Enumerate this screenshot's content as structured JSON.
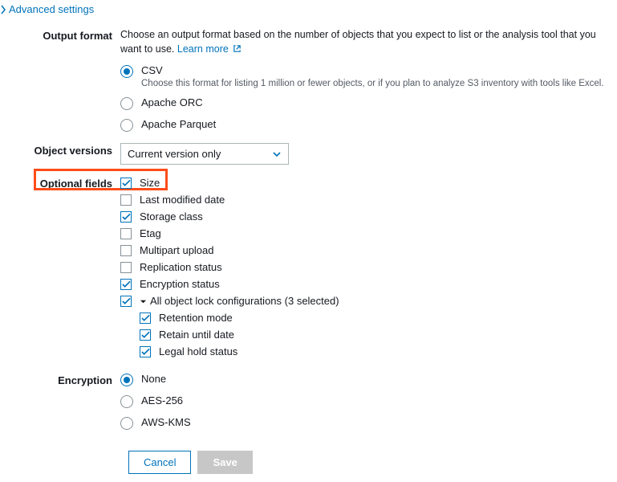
{
  "advanced_link": "Advanced settings",
  "output_format": {
    "label": "Output format",
    "description": "Choose an output format based on the number of objects that you expect to list or the analysis tool that you want to use.",
    "learn_more": "Learn more",
    "options": [
      {
        "label": "CSV",
        "sub": "Choose this format for listing 1 million or fewer objects, or if you plan to analyze S3 inventory with tools like Excel.",
        "selected": true
      },
      {
        "label": "Apache ORC",
        "selected": false
      },
      {
        "label": "Apache Parquet",
        "selected": false
      }
    ]
  },
  "object_versions": {
    "label": "Object versions",
    "selected": "Current version only"
  },
  "optional_fields": {
    "label": "Optional fields",
    "items": [
      {
        "label": "Size",
        "checked": true
      },
      {
        "label": "Last modified date",
        "checked": false
      },
      {
        "label": "Storage class",
        "checked": true
      },
      {
        "label": "Etag",
        "checked": false
      },
      {
        "label": "Multipart upload",
        "checked": false
      },
      {
        "label": "Replication status",
        "checked": false
      },
      {
        "label": "Encryption status",
        "checked": true
      }
    ],
    "lock_group": {
      "checked": true,
      "label": "All object lock configurations (3 selected)",
      "children": [
        {
          "label": "Retention mode",
          "checked": true
        },
        {
          "label": "Retain until date",
          "checked": true
        },
        {
          "label": "Legal hold status",
          "checked": true
        }
      ]
    }
  },
  "encryption": {
    "label": "Encryption",
    "options": [
      {
        "label": "None",
        "selected": true
      },
      {
        "label": "AES-256",
        "selected": false
      },
      {
        "label": "AWS-KMS",
        "selected": false
      }
    ]
  },
  "buttons": {
    "cancel": "Cancel",
    "save": "Save"
  }
}
